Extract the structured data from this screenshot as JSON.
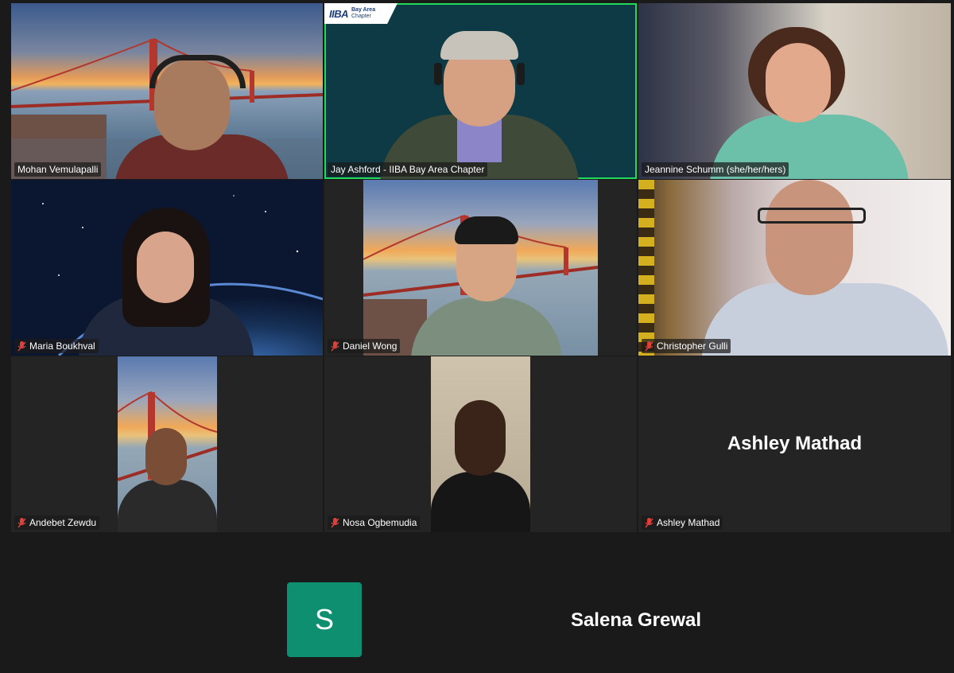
{
  "participants": [
    {
      "name": "Mohan Vemulapalli",
      "muted": false
    },
    {
      "name": "Jay Ashford - IIBA Bay Area Chapter",
      "muted": false,
      "active_speaker": true
    },
    {
      "name": "Jeannine Schumm (she/her/hers)",
      "muted": false
    },
    {
      "name": "Maria Boukhval",
      "muted": true
    },
    {
      "name": "Daniel Wong",
      "muted": true
    },
    {
      "name": "Christopher Gulli",
      "muted": true
    },
    {
      "name": "Andebet Zewdu",
      "muted": true
    },
    {
      "name": "Nosa Ogbemudia",
      "muted": true
    },
    {
      "name": "Ashley Mathad",
      "muted": true,
      "video_off": true
    }
  ],
  "bottom_participant": {
    "name": "Salena Grewal",
    "initial": "S",
    "avatar_color": "#0e8f70"
  },
  "logo": {
    "main": "IIBA",
    "sub_line1": "Bay Area",
    "sub_line2": "Chapter"
  },
  "colors": {
    "active_border": "#23d959",
    "muted_icon": "#e0403a",
    "background": "#1a1a1a"
  }
}
